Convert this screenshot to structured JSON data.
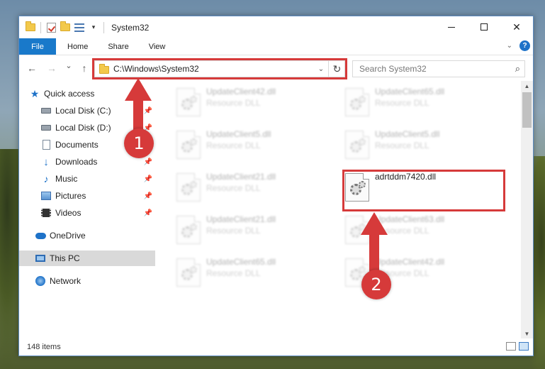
{
  "window": {
    "title": "System32",
    "controls": {
      "minimize": "",
      "maximize": "",
      "close": "✕"
    }
  },
  "ribbon": {
    "tabs": [
      "File",
      "Home",
      "Share",
      "View"
    ],
    "help": "?"
  },
  "navbar": {
    "back": "←",
    "forward": "→",
    "recent": "⌄",
    "up": "↑",
    "address": "C:\\Windows\\System32",
    "refresh": "↻",
    "search_placeholder": "Search System32",
    "search_icon": "⌕"
  },
  "sidebar": {
    "items": [
      {
        "label": "Quick access",
        "icon": "star-icon",
        "pinned": false
      },
      {
        "label": "Local Disk (C:)",
        "icon": "drive-icon",
        "pinned": true
      },
      {
        "label": "Local Disk (D:)",
        "icon": "drive-icon",
        "pinned": true
      },
      {
        "label": "Documents",
        "icon": "document-icon",
        "pinned": true
      },
      {
        "label": "Downloads",
        "icon": "download-icon",
        "pinned": true
      },
      {
        "label": "Music",
        "icon": "music-icon",
        "pinned": true
      },
      {
        "label": "Pictures",
        "icon": "pictures-icon",
        "pinned": true
      },
      {
        "label": "Videos",
        "icon": "videos-icon",
        "pinned": true
      },
      {
        "label": "OneDrive",
        "icon": "onedrive-icon",
        "pinned": false
      },
      {
        "label": "This PC",
        "icon": "pc-icon",
        "pinned": false,
        "selected": true
      },
      {
        "label": "Network",
        "icon": "network-icon",
        "pinned": false
      }
    ]
  },
  "files": [
    {
      "name": "UpdateClient42.dll",
      "desc": "Resource DLL"
    },
    {
      "name": "UpdateClient65.dll",
      "desc": "Resource DLL"
    },
    {
      "name": "UpdateClient5.dll",
      "desc": "Resource DLL"
    },
    {
      "name": "UpdateClient5.dll",
      "desc": "Resource DLL"
    },
    {
      "name": "UpdateClient21.dll",
      "desc": "Resource DLL"
    },
    {
      "name": "adrtddm7420.dll",
      "desc": ""
    },
    {
      "name": "UpdateClient21.dll",
      "desc": "Resource DLL"
    },
    {
      "name": "UpdateClient63.dll",
      "desc": "Resource DLL"
    },
    {
      "name": "UpdateClient65.dll",
      "desc": "Resource DLL"
    },
    {
      "name": "UpdateClient42.dll",
      "desc": "Resource DLL"
    }
  ],
  "status": {
    "item_count": "148 items"
  },
  "callouts": [
    "1",
    "2"
  ],
  "colors": {
    "accent": "#1979ca",
    "highlight": "#d63a3a"
  }
}
